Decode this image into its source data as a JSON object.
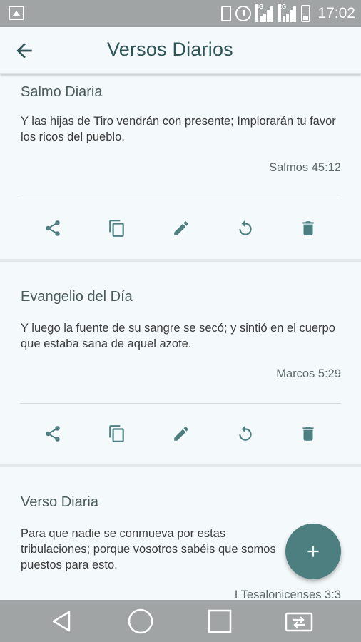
{
  "status_bar": {
    "time": "17:02",
    "icons": [
      "gallery-icon",
      "vibrate-icon",
      "alarm-icon",
      "signal-3g-icon",
      "signal-2g-icon",
      "battery-icon"
    ],
    "network_labels": [
      "3G",
      "2G"
    ]
  },
  "app_bar": {
    "title": "Versos Diarios",
    "back_icon": "arrow-back-icon"
  },
  "cards": [
    {
      "title": "Salmo Diaria",
      "text": "Y las hijas de Tiro vendrán con presente; Implorarán tu favor los ricos del pueblo.",
      "reference": "Salmos 45:12",
      "actions": [
        "share-icon",
        "copy-icon",
        "edit-icon",
        "refresh-icon",
        "delete-icon"
      ]
    },
    {
      "title": "Evangelio del Día",
      "text": "Y luego la fuente de su sangre se secó; y sintió en el cuerpo que estaba sana de aquel azote.",
      "reference": "Marcos 5:29",
      "actions": [
        "share-icon",
        "copy-icon",
        "edit-icon",
        "refresh-icon",
        "delete-icon"
      ]
    },
    {
      "title": "Verso Diaria",
      "text": "Para que nadie se conmueva por estas tribulaciones; porque vosotros sabéis que somos puestos para esto.",
      "reference": "I Tesalonicenses 3:3"
    }
  ],
  "fab": {
    "icon": "add-icon"
  },
  "nav_bar": {
    "icons": [
      "back-triangle-icon",
      "home-circle-icon",
      "recents-square-icon",
      "switch-app-icon"
    ]
  },
  "colors": {
    "background": "#f4f9fb",
    "accent": "#4d7f80",
    "title_text": "#2e5659",
    "system_bar": "#a0a4a4"
  }
}
